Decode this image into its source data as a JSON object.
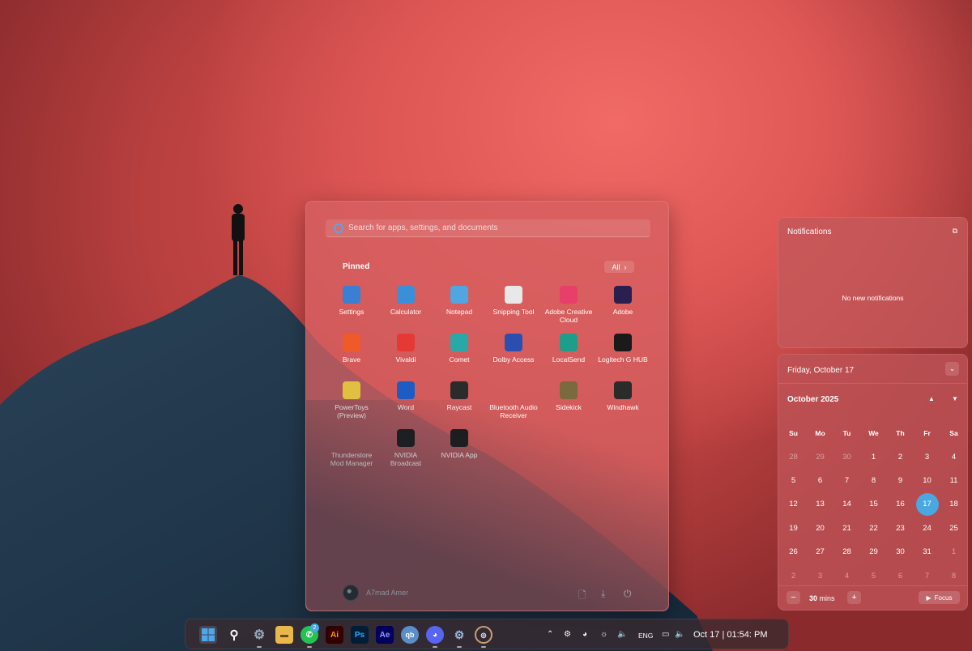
{
  "start_menu": {
    "search_placeholder": "Search for apps, settings, and documents",
    "pinned_label": "Pinned",
    "all_label": "All",
    "apps": [
      {
        "label": "Settings",
        "icon": "gear-icon",
        "color": "#3a7fd1"
      },
      {
        "label": "Calculator",
        "icon": "calculator-icon",
        "color": "#3b8fd9"
      },
      {
        "label": "Notepad",
        "icon": "notepad-icon",
        "color": "#4fa6e0"
      },
      {
        "label": "Snipping Tool",
        "icon": "snipping-icon",
        "color": "#e8e8e8"
      },
      {
        "label": "Adobe Creative Cloud",
        "icon": "creative-cloud-icon",
        "color": "#e83e6c"
      },
      {
        "label": "Adobe",
        "icon": "adobe-suite-icon",
        "color": "#2a2050"
      },
      {
        "label": "Brave",
        "icon": "brave-icon",
        "color": "#f05a28"
      },
      {
        "label": "Vivaldi",
        "icon": "vivaldi-icon",
        "color": "#e53935"
      },
      {
        "label": "Comet",
        "icon": "comet-icon",
        "color": "#2aa8a8"
      },
      {
        "label": "Dolby Access",
        "icon": "dolby-icon",
        "color": "#2b4fb0"
      },
      {
        "label": "LocalSend",
        "icon": "localsend-icon",
        "color": "#1e9e8a"
      },
      {
        "label": "Logitech G HUB",
        "icon": "logitech-icon",
        "color": "#1a1a1a"
      },
      {
        "label": "PowerToys (Preview)",
        "icon": "powertoys-icon",
        "color": "#e0c040"
      },
      {
        "label": "Word",
        "icon": "word-icon",
        "color": "#1d5cc2"
      },
      {
        "label": "Raycast",
        "icon": "raycast-icon",
        "color": "#2b2b2b"
      },
      {
        "label": "Bluetooth Audio Receiver",
        "icon": "music-note-icon",
        "color": "transparent"
      },
      {
        "label": "Sidekick",
        "icon": "sidekick-icon",
        "color": "#7a6a40"
      },
      {
        "label": "Windhawk",
        "icon": "windhawk-icon",
        "color": "#2b2b2b"
      },
      {
        "label": "Thunderstore Mod Manager",
        "icon": "thunderstore-icon",
        "color": "transparent"
      },
      {
        "label": "NVIDIA Broadcast",
        "icon": "nvidia-broadcast-icon",
        "color": "#1a1a1a"
      },
      {
        "label": "NVIDIA App",
        "icon": "nvidia-icon",
        "color": "#1a1a1a"
      }
    ],
    "user_name": "A7mad Amer"
  },
  "notifications": {
    "title": "Notifications",
    "empty_text": "No new notifications"
  },
  "calendar": {
    "date_header": "Friday, October 17",
    "month_label": "October 2025",
    "weekdays": [
      "Su",
      "Mo",
      "Tu",
      "We",
      "Th",
      "Fr",
      "Sa"
    ],
    "weeks": [
      [
        "28",
        "29",
        "30",
        "1",
        "2",
        "3",
        "4"
      ],
      [
        "5",
        "6",
        "7",
        "8",
        "9",
        "10",
        "11"
      ],
      [
        "12",
        "13",
        "14",
        "15",
        "16",
        "17",
        "18"
      ],
      [
        "19",
        "20",
        "21",
        "22",
        "23",
        "24",
        "25"
      ],
      [
        "26",
        "27",
        "28",
        "29",
        "30",
        "31",
        "1"
      ],
      [
        "2",
        "3",
        "4",
        "5",
        "6",
        "7",
        "8"
      ]
    ],
    "today": "17",
    "focus_minutes": "30",
    "focus_unit": "mins",
    "focus_label": "Focus",
    "accent": "#4aa7df"
  },
  "taskbar": {
    "whatsapp_badge": "2",
    "language": "ENG",
    "clock_text": "Oct 17   | 01:54: PM"
  }
}
